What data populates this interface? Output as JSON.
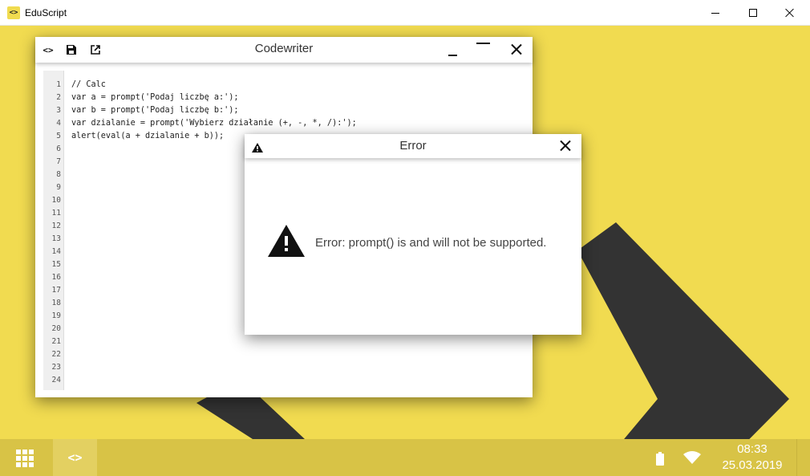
{
  "os_window": {
    "title": "EduScript",
    "app_icon_glyph": "<>",
    "controls": [
      "minimize-icon",
      "maximize-icon",
      "close-icon"
    ]
  },
  "colors": {
    "desktop_bg": "#f1db50",
    "logo_dark": "#333333",
    "taskbar_bg": "#d8c346"
  },
  "codewriter": {
    "title": "Codewriter",
    "toolbar_icons": [
      "code-icon",
      "save-icon",
      "open-external-icon"
    ],
    "code_icon_glyph": "<>",
    "line_numbers": [
      "1",
      "2",
      "3",
      "4",
      "5",
      "6",
      "7",
      "8",
      "9",
      "10",
      "11",
      "12",
      "13",
      "14",
      "15",
      "16",
      "17",
      "18",
      "19",
      "20",
      "21",
      "22",
      "23",
      "24"
    ],
    "code_lines": [
      "// Calc",
      "var a = prompt('Podaj liczbę a:');",
      "var b = prompt('Podaj liczbę b:');",
      "var dzialanie = prompt('Wybierz działanie (+, -, *, /):');",
      "alert(eval(a + dzialanie + b));"
    ]
  },
  "error_dialog": {
    "title": "Error",
    "message": "Error: prompt() is and will not be supported."
  },
  "taskbar": {
    "app_glyph": "<>",
    "time": "08:33",
    "date": "25.03.2019",
    "tray_icons": [
      "battery-icon",
      "wifi-icon"
    ]
  }
}
